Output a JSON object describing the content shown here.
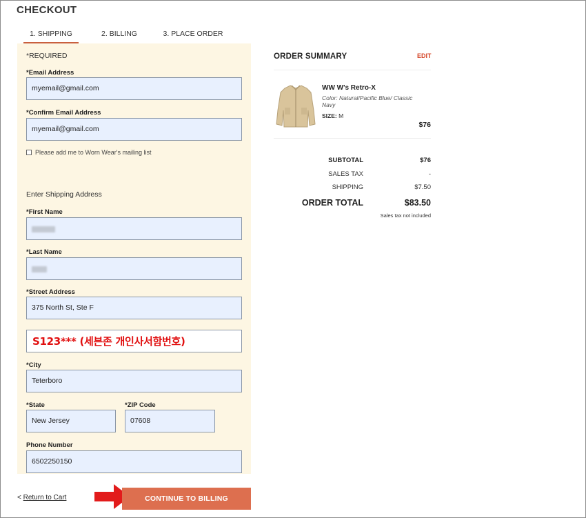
{
  "page_title": "CHECKOUT",
  "tabs": [
    {
      "label": "1. SHIPPING",
      "active": true
    },
    {
      "label": "2. BILLING",
      "active": false
    },
    {
      "label": "3. PLACE ORDER",
      "active": false
    }
  ],
  "form": {
    "required_note": "*REQUIRED",
    "email": {
      "label": "*Email Address",
      "value": "myemail@gmail.com"
    },
    "confirm_email": {
      "label": "*Confirm Email Address",
      "value": "myemail@gmail.com"
    },
    "mailing_list_label": "Please add me to Worn Wear's mailing list",
    "shipping_heading": "Enter Shipping Address",
    "first_name": {
      "label": "*First Name",
      "value": ""
    },
    "last_name": {
      "label": "*Last Name",
      "value": ""
    },
    "street": {
      "label": "*Street Address",
      "value": "375 North St, Ste F"
    },
    "address_line2_overlay": "S123*** (세븐존 개인사서함번호)",
    "city": {
      "label": "*City",
      "value": "Teterboro"
    },
    "state": {
      "label": "*State",
      "value": "New Jersey"
    },
    "zip": {
      "label": "*ZIP Code",
      "value": "07608"
    },
    "phone": {
      "label": "Phone Number",
      "value": "6502250150"
    }
  },
  "footer": {
    "return_prefix": "<",
    "return_label": "Return to Cart",
    "continue_label": "CONTINUE TO BILLING"
  },
  "summary": {
    "title": "ORDER SUMMARY",
    "edit_label": "EDIT",
    "product": {
      "name": "WW W's Retro-X",
      "color": "Color: Natural/Pacific Blue/ Classic Navy",
      "size_label": "SIZE:",
      "size_value": "M",
      "price": "$76"
    },
    "subtotal_label": "SUBTOTAL",
    "subtotal_value": "$76",
    "sales_tax_label": "SALES TAX",
    "sales_tax_value": "-",
    "shipping_label": "SHIPPING",
    "shipping_value": "$7.50",
    "order_total_label": "ORDER TOTAL",
    "order_total_value": "$83.50",
    "tax_note": "Sales tax not included"
  },
  "colors": {
    "accent": "#dd6f4f",
    "panel": "#fdf6e3",
    "input_bg": "#e8f0fe",
    "annotation": "#e10f0f"
  }
}
